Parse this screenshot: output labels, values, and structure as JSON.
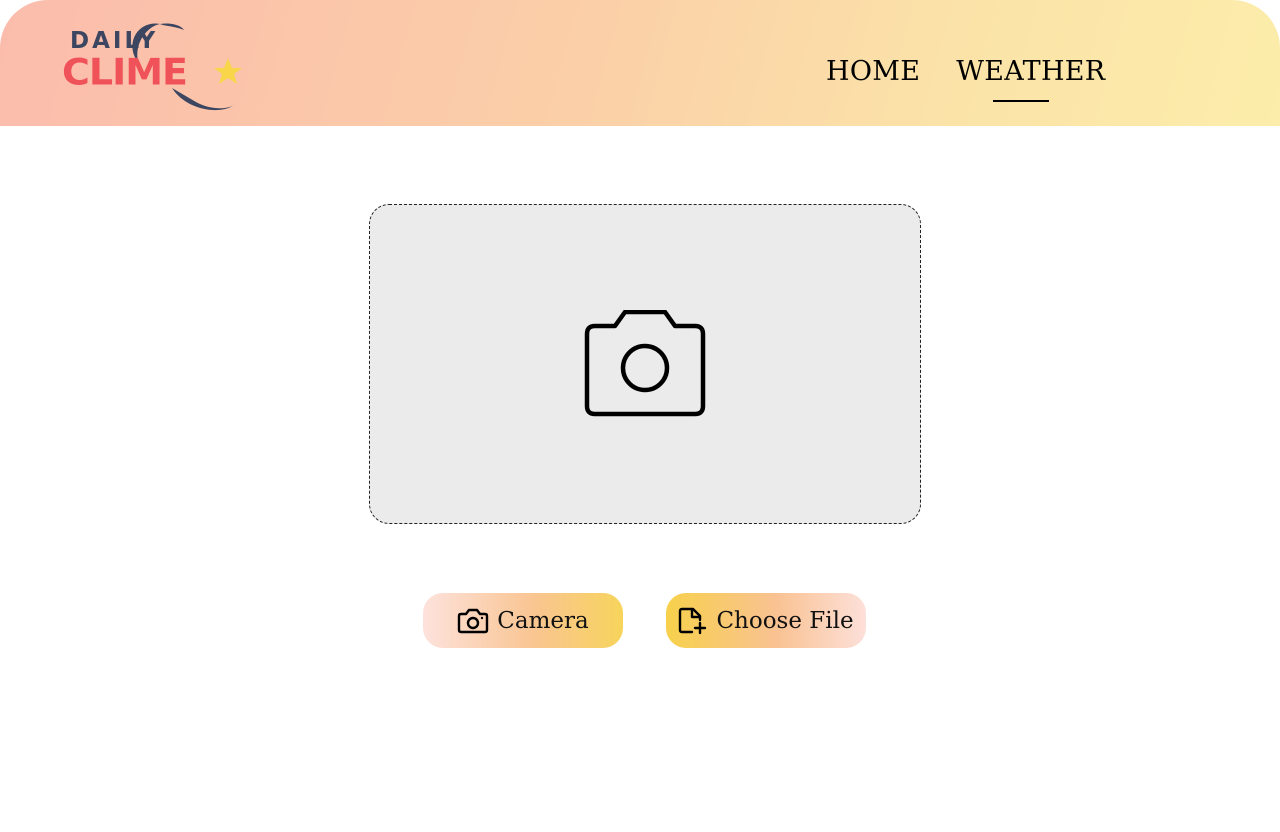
{
  "brand": {
    "line1": "DAILY",
    "line2": "CLIME",
    "colors": {
      "daily": "#3c4660",
      "clime": "#f0525a",
      "star": "#f7d64a"
    }
  },
  "nav": {
    "items": [
      {
        "label": "HOME",
        "active": false
      },
      {
        "label": "WEATHER",
        "active": true
      }
    ]
  },
  "upload": {
    "preview_icon": "camera-icon",
    "camera_button": {
      "label": "Camera",
      "icon": "camera-icon"
    },
    "file_button": {
      "label": "Choose File",
      "icon": "file-add-icon"
    }
  },
  "colors": {
    "header_gradient": [
      "#fbbcac",
      "#fcedaa"
    ],
    "dropzone_bg": "#ebebeb"
  }
}
